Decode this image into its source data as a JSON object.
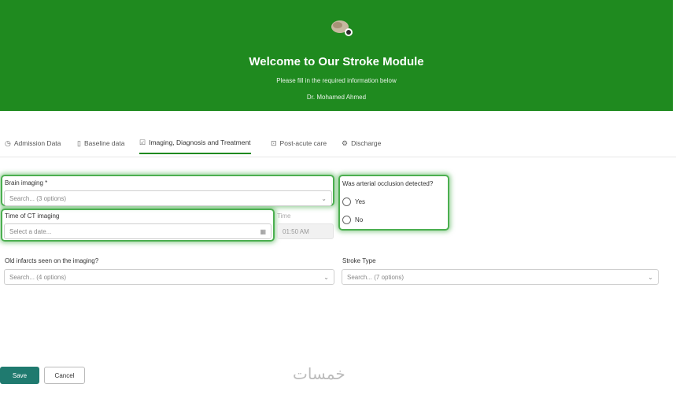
{
  "header": {
    "title": "Welcome to Our Stroke Module",
    "subtitle": "Please fill in the required information below",
    "user": "Dr. Mohamed Ahmed",
    "bg_color": "#1f8a1f"
  },
  "tabs": [
    {
      "label": "Admission Data",
      "icon": "clock-icon"
    },
    {
      "label": "Baseline data",
      "icon": "document-icon"
    },
    {
      "label": "Imaging, Diagnosis and Treatment",
      "icon": "checklist-icon",
      "active": true
    },
    {
      "label": "Post-acute care",
      "icon": "lock-icon"
    },
    {
      "label": "Discharge",
      "icon": "settings-icon"
    }
  ],
  "form": {
    "brain_imaging": {
      "label": "Brain imaging *",
      "placeholder": "Search... (3 options)"
    },
    "time_ct": {
      "label": "Time of CT imaging",
      "placeholder": "Select a date..."
    },
    "time": {
      "label": "Time",
      "value": "01:50 AM"
    },
    "arterial": {
      "label": "Was arterial occlusion detected?",
      "options": [
        "Yes",
        "No"
      ]
    },
    "old_infarcts": {
      "label": "Old infarcts seen on the imaging?",
      "placeholder": "Search... (4 options)"
    },
    "stroke_type": {
      "label": "Stroke Type",
      "placeholder": "Search... (7 options)"
    }
  },
  "actions": {
    "save": "Save",
    "cancel": "Cancel"
  },
  "watermark": "خمسات"
}
